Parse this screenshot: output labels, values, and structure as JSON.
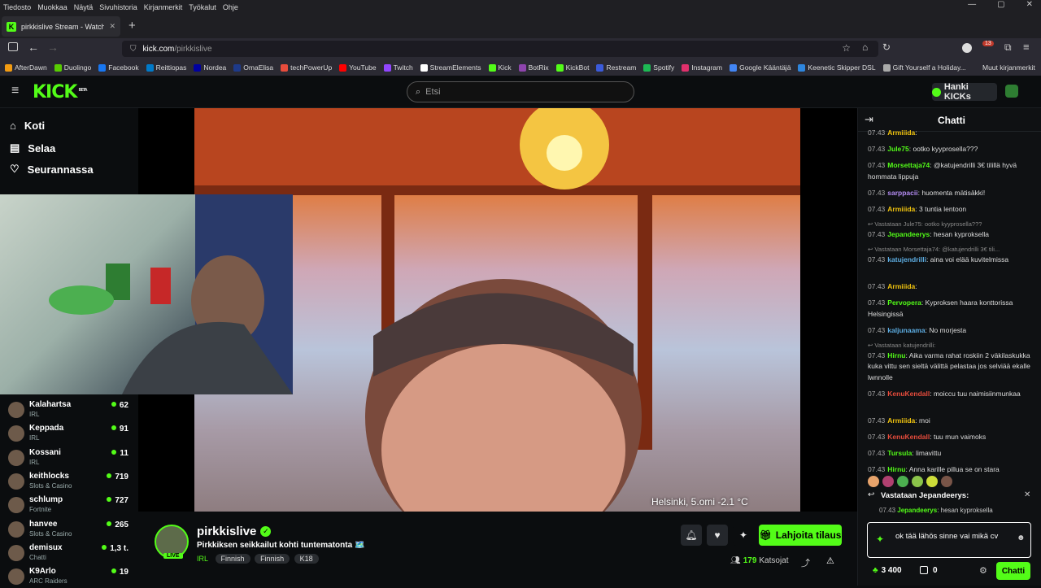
{
  "menubar": {
    "items": [
      "Tiedosto",
      "Muokkaa",
      "Näytä",
      "Sivuhistoria",
      "Kirjanmerkit",
      "Työkalut",
      "Ohje"
    ],
    "controls": [
      "—",
      "▢",
      "✕"
    ]
  },
  "tab": {
    "title": "pirkkislive Stream - Watch L",
    "close": "✕",
    "new": "+"
  },
  "url": {
    "domain": "kick.com",
    "path": "/pirkkislive",
    "extension_badge": "13"
  },
  "bookmarks": [
    {
      "label": "AfterDawn",
      "color": "#f39c12"
    },
    {
      "label": "Duolingo",
      "color": "#58cc02"
    },
    {
      "label": "Facebook",
      "color": "#1877f2"
    },
    {
      "label": "Reittiopas",
      "color": "#007ac9"
    },
    {
      "label": "Nordea",
      "color": "#0000a0"
    },
    {
      "label": "OmaElisa",
      "color": "#1e3a8a"
    },
    {
      "label": "techPowerUp",
      "color": "#e74c3c"
    },
    {
      "label": "YouTube",
      "color": "#ff0000"
    },
    {
      "label": "Twitch",
      "color": "#9146ff"
    },
    {
      "label": "StreamElements",
      "color": "#fff"
    },
    {
      "label": "Kick",
      "color": "#53fc18"
    },
    {
      "label": "BotRix",
      "color": "#8e44ad"
    },
    {
      "label": "KickBot",
      "color": "#53fc18"
    },
    {
      "label": "Restream",
      "color": "#3b5bdb"
    },
    {
      "label": "Spotify",
      "color": "#1db954"
    },
    {
      "label": "Instagram",
      "color": "#e1306c"
    },
    {
      "label": "Google Kääntäjä",
      "color": "#4285f4"
    },
    {
      "label": "Keenetic Skipper DSL",
      "color": "#2e86de"
    },
    {
      "label": "Gift Yourself a Holiday...",
      "color": "#aaa"
    }
  ],
  "bookmarks_other": "Muut kirjanmerkit",
  "header": {
    "logo": "KICK",
    "logo_sup": "BETA",
    "search_placeholder": "Etsi",
    "get_kicks": "Hanki KICKs"
  },
  "sidebar": {
    "nav": [
      {
        "label": "Koti",
        "icon": "home-icon"
      },
      {
        "label": "Selaa",
        "icon": "browse-icon"
      },
      {
        "label": "Seurannassa",
        "icon": "heart-icon"
      }
    ],
    "channels": [
      {
        "name": "Kalahartsa",
        "category": "IRL",
        "viewers": "62"
      },
      {
        "name": "Keppada",
        "category": "IRL",
        "viewers": "91"
      },
      {
        "name": "Kossani",
        "category": "IRL",
        "viewers": "11"
      },
      {
        "name": "keithlocks",
        "category": "Slots & Casino",
        "viewers": "719"
      },
      {
        "name": "schlump",
        "category": "Fortnite",
        "viewers": "727"
      },
      {
        "name": "hanvee",
        "category": "Slots & Casino",
        "viewers": "265"
      },
      {
        "name": "demisux",
        "category": "Chatti",
        "viewers": "1,3 t."
      },
      {
        "name": "K9Arlo",
        "category": "ARC Raiders",
        "viewers": "19"
      }
    ]
  },
  "video": {
    "overlay": "Helsinki, 5.omi  -2.1 °C"
  },
  "stream": {
    "channel": "pirkkislive",
    "live": "LIVE",
    "title": "Pirkkiksen seikkailut kohti tuntematonta 🗺️",
    "category": "IRL",
    "tags": [
      "Finnish",
      "Finnish",
      "K18"
    ],
    "subscribe": "Lahjoita tilaus",
    "viewers": "179",
    "viewers_label": "Katsojat"
  },
  "chat": {
    "title": "Chatti",
    "messages": [
      {
        "time": "07.43",
        "user": "Armiiida",
        "color": "#f1c40f",
        "text": ""
      },
      {
        "time": "07.43",
        "user": "Jule75",
        "color": "#53fc18",
        "text": "ootko kyyprosella???"
      },
      {
        "time": "07.43",
        "user": "Morsettaja74",
        "color": "#53fc18",
        "text": "@katujendrilli 3€ tilillä hyvä hommata lippuja"
      },
      {
        "time": "07.43",
        "user": "sarppacii",
        "color": "#b48cf2",
        "text": "huomenta mätisäkki!"
      },
      {
        "time": "07.43",
        "user": "Armiiida",
        "color": "#f1c40f",
        "text": "3 tuntia lentoon"
      },
      {
        "time": "07.43",
        "user": "Jepandeerys",
        "color": "#53fc18",
        "text": "hesan kyproksella",
        "reply": "Vastataan Jule75: ootko kyyprosella???"
      },
      {
        "time": "07.43",
        "user": "katujendrilli",
        "color": "#5dade2",
        "text": "aina voi elää kuvitelmissa",
        "reply": "Vastataan Morsettaja74: @katujendrilli 3€ tili..."
      },
      {
        "time": "07.43",
        "user": "Armiiida",
        "color": "#f1c40f",
        "text": ""
      },
      {
        "time": "07.43",
        "user": "Pervopera",
        "color": "#53fc18",
        "text": "Kyproksen haara konttorissa Helsingissä"
      },
      {
        "time": "07.43",
        "user": "kaljunaama",
        "color": "#5dade2",
        "text": "No morjesta"
      },
      {
        "time": "07.43",
        "user": "Hirnu",
        "color": "#53fc18",
        "text": "Aika varma rahat roskiin 2 väkilaskukka kuka vittu sen sieltä välittä pelastaa jos selviää ekalle lwnnolle",
        "reply": "Vastataan katujendrilli:"
      },
      {
        "time": "07.43",
        "user": "KenuKendall",
        "color": "#e74c3c",
        "text": "moiccu tuu naimisiinmunkaa"
      },
      {
        "time": "07.43",
        "user": "Armiiida",
        "color": "#f1c40f",
        "text": "moi"
      },
      {
        "time": "07.43",
        "user": "KenuKendall",
        "color": "#e74c3c",
        "text": "tuu mun vaimoks"
      },
      {
        "time": "07.43",
        "user": "Tursula",
        "color": "#53fc18",
        "text": "limavittu"
      },
      {
        "time": "07.43",
        "user": "Hirnu",
        "color": "#53fc18",
        "text": "Anna karille pillua se on stara"
      }
    ],
    "replying_to": "Vastataan Jepandeerys:",
    "reply_preview": {
      "time": "07.43",
      "user": "Jepandeerys",
      "text": "hesan kyproksella"
    },
    "input": "ok tää lähös sinne vai mikä cv",
    "points": "3 400",
    "kicks": "0",
    "send": "Chatti"
  }
}
